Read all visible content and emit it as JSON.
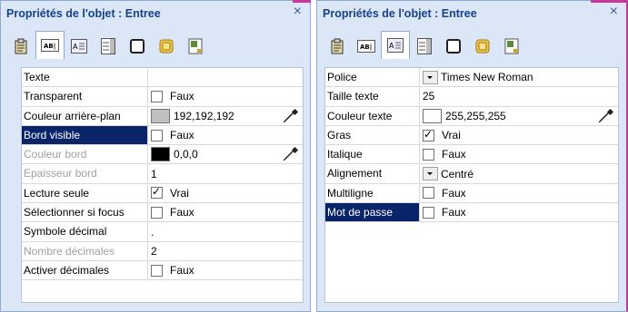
{
  "left": {
    "title": "Propriétés de l'objet : Entree",
    "close": "×",
    "tabs": [
      "clipboard-icon",
      "text-field-icon",
      "label-icon",
      "list-icon",
      "frame-icon",
      "button-icon",
      "form-icon"
    ],
    "active_tab": 1,
    "rows": [
      {
        "label": "Texte",
        "kind": "text",
        "value": ""
      },
      {
        "label": "Transparent",
        "kind": "check",
        "checked": false,
        "value": "Faux"
      },
      {
        "label": "Couleur arrière-plan",
        "kind": "color",
        "color": "#c0c0c0",
        "value": "192,192,192"
      },
      {
        "label": "Bord visible",
        "kind": "check",
        "checked": false,
        "value": "Faux",
        "selected": true
      },
      {
        "label": "Couleur bord",
        "kind": "color",
        "color": "#000000",
        "value": "0,0,0",
        "disabled": true
      },
      {
        "label": "Epaisseur bord",
        "kind": "text",
        "value": "1",
        "disabled": true
      },
      {
        "label": "Lecture seule",
        "kind": "check",
        "checked": true,
        "value": "Vrai"
      },
      {
        "label": "Sélectionner si focus",
        "kind": "check",
        "checked": false,
        "value": "Faux"
      },
      {
        "label": "Symbole décimal",
        "kind": "text",
        "value": "."
      },
      {
        "label": "Nombre décimales",
        "kind": "text",
        "value": "2",
        "disabled": true
      },
      {
        "label": "Activer décimales",
        "kind": "check",
        "checked": false,
        "value": "Faux"
      }
    ]
  },
  "right": {
    "title": "Propriétés de l'objet : Entree",
    "close": "×",
    "tabs": [
      "clipboard-icon",
      "text-field-icon",
      "label-icon",
      "list-icon",
      "frame-icon",
      "button-icon",
      "form-icon"
    ],
    "active_tab": 2,
    "rows": [
      {
        "label": "Police",
        "kind": "dropdown",
        "value": "Times New Roman"
      },
      {
        "label": "Taille texte",
        "kind": "text",
        "value": "25"
      },
      {
        "label": "Couleur texte",
        "kind": "color",
        "color": "#ffffff",
        "value": "255,255,255"
      },
      {
        "label": "Gras",
        "kind": "check",
        "checked": true,
        "value": "Vrai"
      },
      {
        "label": "Italique",
        "kind": "check",
        "checked": false,
        "value": "Faux"
      },
      {
        "label": "Alignement",
        "kind": "dropdown",
        "value": "Centré"
      },
      {
        "label": "Multiligne",
        "kind": "check",
        "checked": false,
        "value": "Faux"
      },
      {
        "label": "Mot de passe",
        "kind": "check",
        "checked": false,
        "value": "Faux",
        "selected": true
      }
    ]
  }
}
